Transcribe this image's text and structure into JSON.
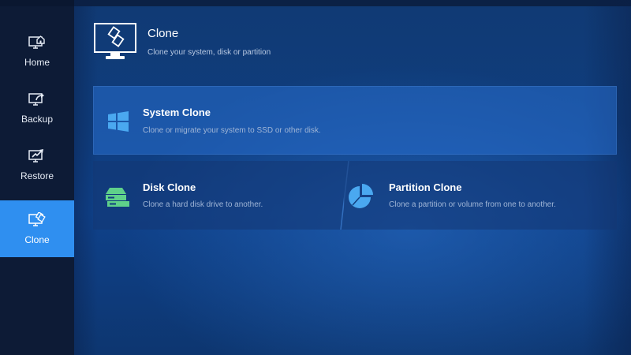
{
  "sidebar": {
    "items": [
      {
        "label": "Home",
        "icon": "home-icon",
        "active": false
      },
      {
        "label": "Backup",
        "icon": "backup-icon",
        "active": false
      },
      {
        "label": "Restore",
        "icon": "restore-icon",
        "active": false
      },
      {
        "label": "Clone",
        "icon": "clone-icon",
        "active": true
      }
    ]
  },
  "header": {
    "title": "Clone",
    "subtitle": "Clone your system, disk or partition",
    "icon": "clone-monitor-icon"
  },
  "cards": {
    "system": {
      "title": "System Clone",
      "description": "Clone or migrate your system to SSD or other disk.",
      "icon": "windows-icon"
    },
    "disk": {
      "title": "Disk Clone",
      "description": "Clone a hard disk drive to another.",
      "icon": "disk-drive-icon"
    },
    "partition": {
      "title": "Partition Clone",
      "description": "Clone a partition or volume from one to another.",
      "icon": "pie-chart-icon"
    }
  },
  "colors": {
    "sidebar_bg": "#0d1b36",
    "active_item": "#2f8ff0",
    "main_bg": "#0f3d7d",
    "accent_icon": "#4aa8f0",
    "disk_icon": "#5fd08a"
  }
}
